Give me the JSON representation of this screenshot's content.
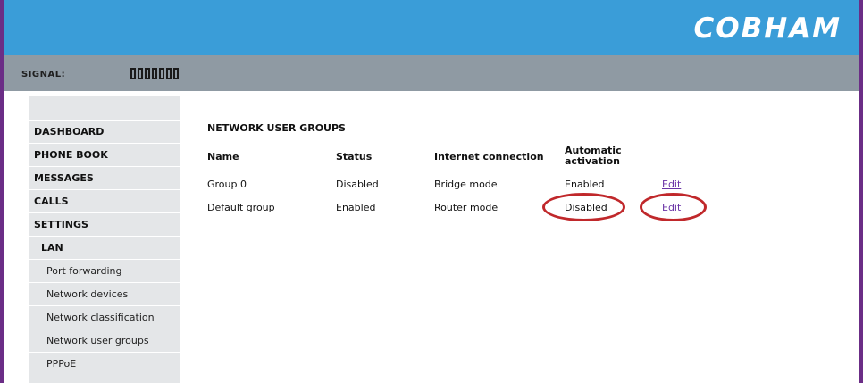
{
  "brand": {
    "logo": "COBHAM"
  },
  "signal": {
    "label": "SIGNAL:",
    "bars_total": 7,
    "bars_filled": 0
  },
  "sidebar": {
    "items": [
      {
        "label": "DASHBOARD",
        "level": 0
      },
      {
        "label": "PHONE BOOK",
        "level": 0
      },
      {
        "label": "MESSAGES",
        "level": 0
      },
      {
        "label": "CALLS",
        "level": 0
      },
      {
        "label": "SETTINGS",
        "level": 0
      },
      {
        "label": "LAN",
        "level": 1
      },
      {
        "label": "Port forwarding",
        "level": 2
      },
      {
        "label": "Network devices",
        "level": 2
      },
      {
        "label": "Network classification",
        "level": 2
      },
      {
        "label": "Network user groups",
        "level": 2
      },
      {
        "label": "PPPoE",
        "level": 2
      }
    ]
  },
  "main": {
    "title": "NETWORK USER GROUPS",
    "columns": {
      "name": "Name",
      "status": "Status",
      "internet": "Internet connection",
      "auto_line1": "Automatic",
      "auto_line2": "activation"
    },
    "rows": [
      {
        "name": "Group 0",
        "status": "Disabled",
        "internet": "Bridge mode",
        "auto": "Enabled",
        "action": "Edit"
      },
      {
        "name": "Default group",
        "status": "Enabled",
        "internet": "Router mode",
        "auto": "Disabled",
        "action": "Edit"
      }
    ]
  },
  "colors": {
    "header": "#3a9dd8",
    "signal_bar": "#8f9aa3",
    "frame": "#6b2d86",
    "highlight": "#c0282b",
    "link": "#6a33a6"
  }
}
